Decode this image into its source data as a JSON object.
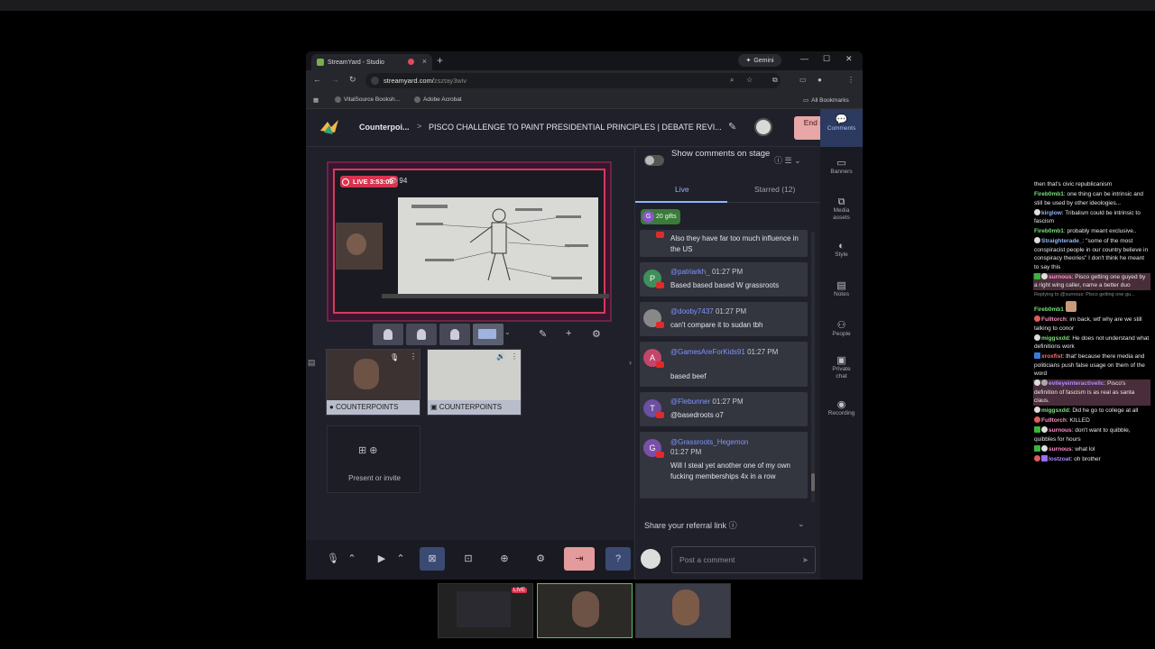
{
  "browser": {
    "tab_title": "StreamYard - Studio",
    "gemini_label": "Gemini",
    "url": "streamyard.com/",
    "url_path": "zsztay3wiv",
    "bookmarks": [
      "VitalSource Booksh...",
      "Adobe Acrobat"
    ],
    "all_bookmarks": "All Bookmarks"
  },
  "app": {
    "breadcrumb_show": "Counterpoi...",
    "breadcrumb_sep": ">",
    "broadcast_title": "PISCO CHALLENGE TO PAINT PRESIDENTIAL PRINCIPLES | DEBATE REVI...",
    "end_stream": "End stream",
    "live_timer": "LIVE 3:53:09",
    "viewer_count": "94",
    "participants": [
      {
        "name": "COUNTERPOINTS"
      },
      {
        "name": "COUNTERPOINTS"
      }
    ],
    "present_label": "Present or invite"
  },
  "chat": {
    "show_comments": "Show comments on stage",
    "tab_live": "Live",
    "tab_starred": "Starred (12)",
    "gifts": "20 gifts",
    "messages": [
      {
        "user": "",
        "time": "",
        "text": "Also they have far too much influence in the US",
        "initial": "",
        "color": "#555"
      },
      {
        "user": "@patriarkh_",
        "time": "01:27 PM",
        "text": "Based based based W grassroots",
        "initial": "P",
        "color": "#3f8f5a"
      },
      {
        "user": "@dooby7437",
        "time": "01:27 PM",
        "text": "can't compare it to sudan tbh",
        "initial": "",
        "color": "#888"
      },
      {
        "user": "@GamesAreForKids91",
        "time": "01:27 PM",
        "text": "based beef",
        "initial": "A",
        "color": "#c2466a"
      },
      {
        "user": "@Flebunner",
        "time": "01:27 PM",
        "text": "@basedroots o7",
        "initial": "T",
        "color": "#6a4fa3"
      },
      {
        "user": "@Grassroots_Hegemon",
        "time": "01:27 PM",
        "text": "Will I steal yet another one of my own fucking memberships 4x in a row",
        "initial": "G",
        "color": "#7a4fa8"
      }
    ],
    "referral": "Share your referral link",
    "post_placeholder": "Post a comment"
  },
  "rail": [
    {
      "label": "Comments",
      "icon": "comment-icon"
    },
    {
      "label": "Banners",
      "icon": "banner-icon"
    },
    {
      "label": "Media assets",
      "icon": "media-icon"
    },
    {
      "label": "Style",
      "icon": "palette-icon"
    },
    {
      "label": "Notes",
      "icon": "notes-icon"
    },
    {
      "label": "People",
      "icon": "people-icon"
    },
    {
      "label": "Private chat",
      "icon": "private-chat-icon"
    },
    {
      "label": "Recording",
      "icon": "record-icon"
    }
  ],
  "twitch_chat": [
    {
      "user": "",
      "text": "then that's civic republicanism",
      "color": "#e8e8e8"
    },
    {
      "user": "Fireb0mb1",
      "text": ": one thing can be intrinsic and still be used by other ideologies...",
      "color": "#7be07b"
    },
    {
      "user": "kirglow",
      "text": ": Tribalism could be intrinsic to fascism",
      "color": "#8fb7ff"
    },
    {
      "user": "Fireb0mb1",
      "text": ": probably meant exclusive..",
      "color": "#7be07b"
    },
    {
      "user": "Straighterade_",
      "text": ": \"some of the most conspiracist people in our country believe in conspiracy theories\" I don't think he meant to say this",
      "color": "#8fb7ff"
    },
    {
      "user": "surnous",
      "text": ": Pisco getting one guyed by a right wing caller, name a better duo",
      "color": "#ff8fc7"
    },
    {
      "user": "",
      "text": "Replying to @surnous: Pisco getting one gu...",
      "color": "#8d8d8d"
    },
    {
      "user": "Fireb0mb1",
      "text": "",
      "color": "#7be07b"
    },
    {
      "user": "Fulltorch",
      "text": ": im back, wtf why are we still talking to conor",
      "color": "#ff8fc7"
    },
    {
      "user": "miggsxdd",
      "text": ": He does not understand what definitions work",
      "color": "#7be07b"
    },
    {
      "user": "xroxfist",
      "text": ": that' because there media and politicians push false usage on them of the word",
      "color": "#ff6f6f"
    },
    {
      "user": "evileyeinteractivellc",
      "text": ": Pisco's definition of fascism is as real as santa claus.",
      "color": "#b08cff"
    },
    {
      "user": "miggsxdd",
      "text": ": Did he go to college at all",
      "color": "#7be07b"
    },
    {
      "user": "Fulltorch",
      "text": ": KILLED",
      "color": "#ff8fc7"
    },
    {
      "user": "surnous",
      "text": ": don't want to quibble, quibbles for hours",
      "color": "#ff8fc7"
    },
    {
      "user": "surnous",
      "text": ": what lol",
      "color": "#ff8fc7"
    },
    {
      "user": "lostzoat",
      "text": ": oh brother",
      "color": "#b08cff"
    }
  ],
  "preview_live": "LIVE"
}
